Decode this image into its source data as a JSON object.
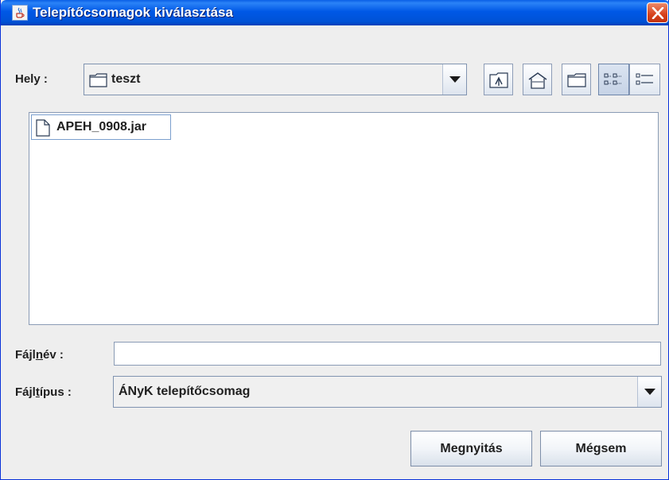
{
  "window": {
    "title": "Telepítőcsomagok kiválasztása",
    "icon": "java-cup-icon",
    "close_icon": "close-icon"
  },
  "location": {
    "label_text": "Hely",
    "label_colon": ":",
    "value": "teszt",
    "value_icon": "folder-icon"
  },
  "toolbar": {
    "buttons": [
      {
        "name": "up-one-level",
        "icon": "folder-up-icon"
      },
      {
        "name": "home",
        "icon": "home-icon"
      },
      {
        "name": "new-folder",
        "icon": "new-folder-icon"
      },
      {
        "name": "list-view",
        "icon": "list-view-icon",
        "selected": true
      },
      {
        "name": "details-view",
        "icon": "details-view-icon"
      }
    ]
  },
  "files": [
    {
      "name": "APEH_0908.jar",
      "icon": "file-icon",
      "selected": true
    }
  ],
  "filename": {
    "label_pre": "Fájl",
    "label_mnemonic": "n",
    "label_post": "év",
    "label_colon": ":",
    "value": ""
  },
  "filetype": {
    "label_pre": "Fájl",
    "label_mnemonic": "t",
    "label_post": "ípus",
    "label_colon": ":",
    "value": "ÁNyK telepítőcsomag"
  },
  "buttons": {
    "open_label": "Megnyitás",
    "cancel_label": "Mégsem"
  },
  "colors": {
    "titlebar": "#0058e6",
    "window_bg": "#eeeeee",
    "close_button": "#d7421c",
    "selection_border": "#7b9fce"
  }
}
